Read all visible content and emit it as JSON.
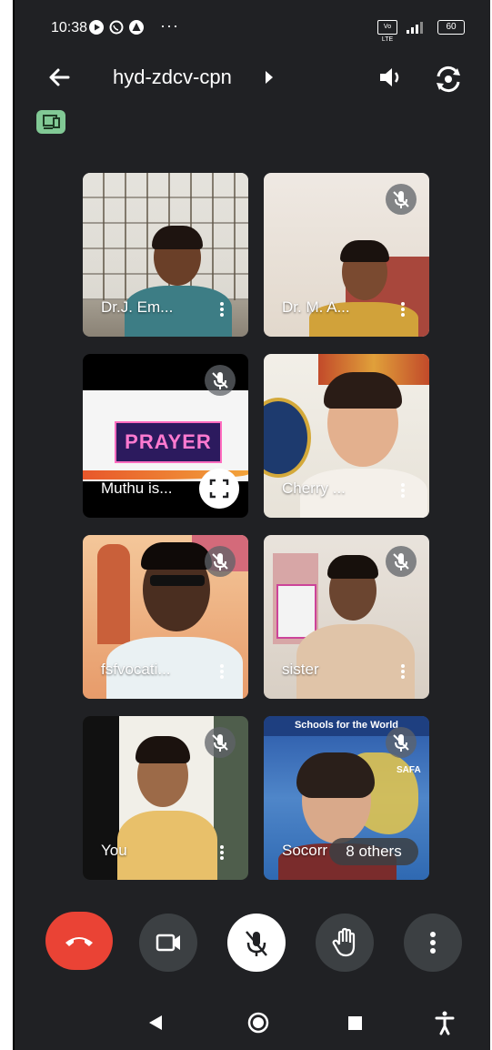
{
  "status_bar": {
    "time": "10:38",
    "more": "···",
    "volte": "Vo LTE",
    "battery": "60"
  },
  "header": {
    "meeting_code": "hyd-zdcv-cpn"
  },
  "participants": [
    {
      "name": "Dr.J. Em...",
      "muted": false
    },
    {
      "name": "Dr. M. A...",
      "muted": true
    },
    {
      "name": "Muthu is...",
      "muted": true,
      "presenting_text": "PRAYER"
    },
    {
      "name": "Cherry ...",
      "muted": false
    },
    {
      "name": "fsfvocati...",
      "muted": true
    },
    {
      "name": "sister",
      "muted": true
    },
    {
      "name": "You",
      "muted": true
    },
    {
      "name": "Socorr",
      "muted": true,
      "slide_header": "Schools for the World",
      "slide_logo": "SAFA"
    }
  ],
  "others_chip": "8 others",
  "colors": {
    "background": "#202124",
    "end_call": "#ea4335",
    "control": "#3c4043",
    "cast_chip": "#81c995"
  },
  "icons": [
    "back-arrow-icon",
    "dropdown-arrow-icon",
    "speaker-icon",
    "flip-camera-icon",
    "cast-device-icon",
    "mic-off-icon",
    "more-vert-icon",
    "fullscreen-icon",
    "end-call-icon",
    "camera-icon",
    "raise-hand-icon",
    "nav-back-icon",
    "nav-home-icon",
    "nav-recents-icon",
    "accessibility-icon"
  ]
}
